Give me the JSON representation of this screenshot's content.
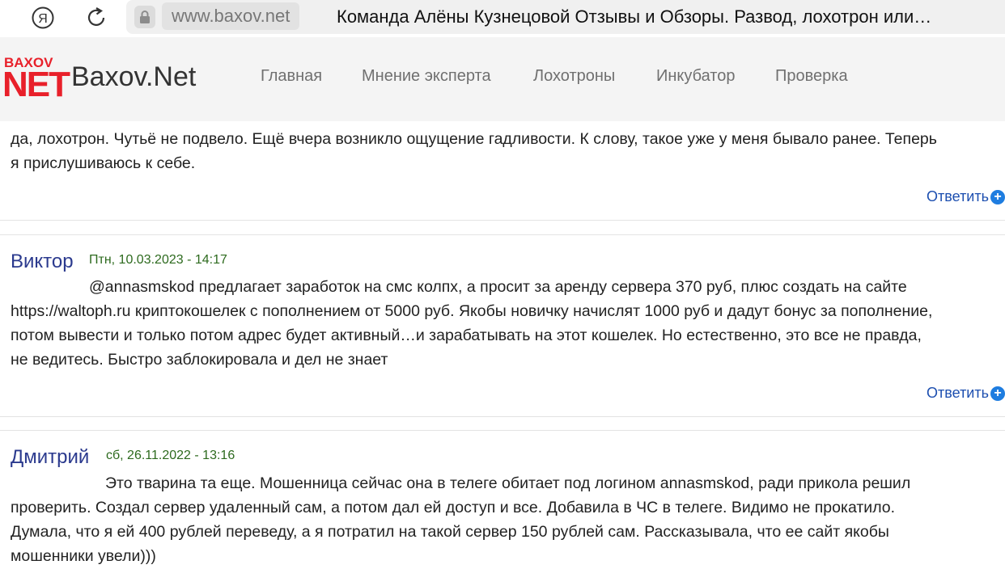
{
  "browser": {
    "domain": "www.baxov.net",
    "title": "Команда Алёны Кузнецовой Отзывы и Обзоры. Развод, лохотрон или…"
  },
  "site": {
    "logo_top": "BAXOV",
    "logo_net": "NET",
    "name": "Baxov.Net",
    "nav": [
      "Главная",
      "Мнение эксперта",
      "Лохотроны",
      "Инкубатор",
      "Проверка"
    ]
  },
  "comments": [
    {
      "lines": [
        "да, лохотрон. Чутьё не подвело. Ещё вчера возникло ощущение гадливости. К слову, такое уже у меня бывало ранее. Теперь",
        "я прислушиваюсь к себе."
      ],
      "reply_label": "Ответить"
    },
    {
      "author": "Виктор",
      "day": "Птн, 10.03.2023",
      "sep": " - ",
      "time": "14:17",
      "lines": [
        "@annasmskod предлагает заработок на смс колпх, а просит за аренду сервера 370 руб, плюс создать на сайте",
        "https://waltoph.ru криптокошелек с пополнением от 5000 руб. Якобы новичку начислят 1000 руб и дадут бонус за пополнение,",
        "потом вывести и только потом адрес будет активный…и зарабатывать на этот кошелек. Но естественно, это все не правда,",
        "не ведитесь. Быстро заблокировала и дел не знает"
      ],
      "reply_label": "Ответить"
    },
    {
      "author": "Дмитрий",
      "day": "сб, 26.11.2022",
      "sep": " - ",
      "time": "13:16",
      "lines": [
        "Это тварина та еще. Мошенница сейчас она в телеге обитает под логином annasmskod, ради прикола решил",
        "проверить. Создал сервер удаленный сам, а потом дал ей доступ и все. Добавила в ЧС в телеге. Видимо не прокатило.",
        "Думала, что я ей 400 рублей переведу, а я потратил на такой сервер 150 рублей сам. Рассказывала, что ее сайт якобы",
        "мошенники увели)))"
      ]
    }
  ]
}
